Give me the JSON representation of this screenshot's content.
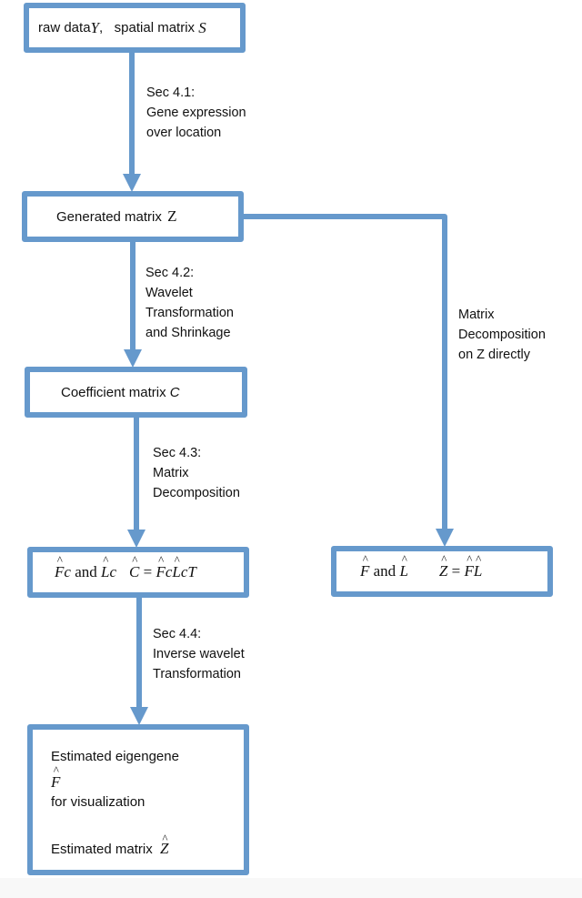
{
  "colors": {
    "accent": "#6699cc",
    "text": "#111111",
    "background": "#ffffff"
  },
  "nodes": {
    "raw": {
      "text": "raw data ",
      "var1": "Y",
      "sep": ",   spatial matrix ",
      "var2": "S"
    },
    "generated": {
      "text": "Generated matrix ",
      "var": "Z"
    },
    "coefficient": {
      "text": "Coefficient matrix ",
      "var": "C"
    },
    "fc": {
      "f": "F",
      "f_sub": "c",
      "and": " and ",
      "l": "L",
      "l_sub": "c",
      "c": "C",
      "eq": " = ",
      "t": "T"
    },
    "fl": {
      "f": "F",
      "and": " and ",
      "l": "L",
      "z": "Z",
      "eq": " = "
    },
    "estimated": {
      "line1": "Estimated eigengene",
      "f": "F",
      "line3": "for visualization",
      "line4": "Estimated matrix ",
      "z": "Z"
    }
  },
  "edges": {
    "sec41": [
      "Sec 4.1:",
      "Gene expression",
      "over location"
    ],
    "sec42": [
      "Sec 4.2:",
      "Wavelet",
      "Transformation",
      "and Shrinkage"
    ],
    "sec43": [
      "Sec 4.3:",
      "Matrix",
      "Decomposition"
    ],
    "sec44": [
      "Sec 4.4:",
      "Inverse wavelet",
      "Transformation"
    ],
    "direct": [
      "Matrix",
      "Decomposition",
      "on Z directly"
    ]
  }
}
